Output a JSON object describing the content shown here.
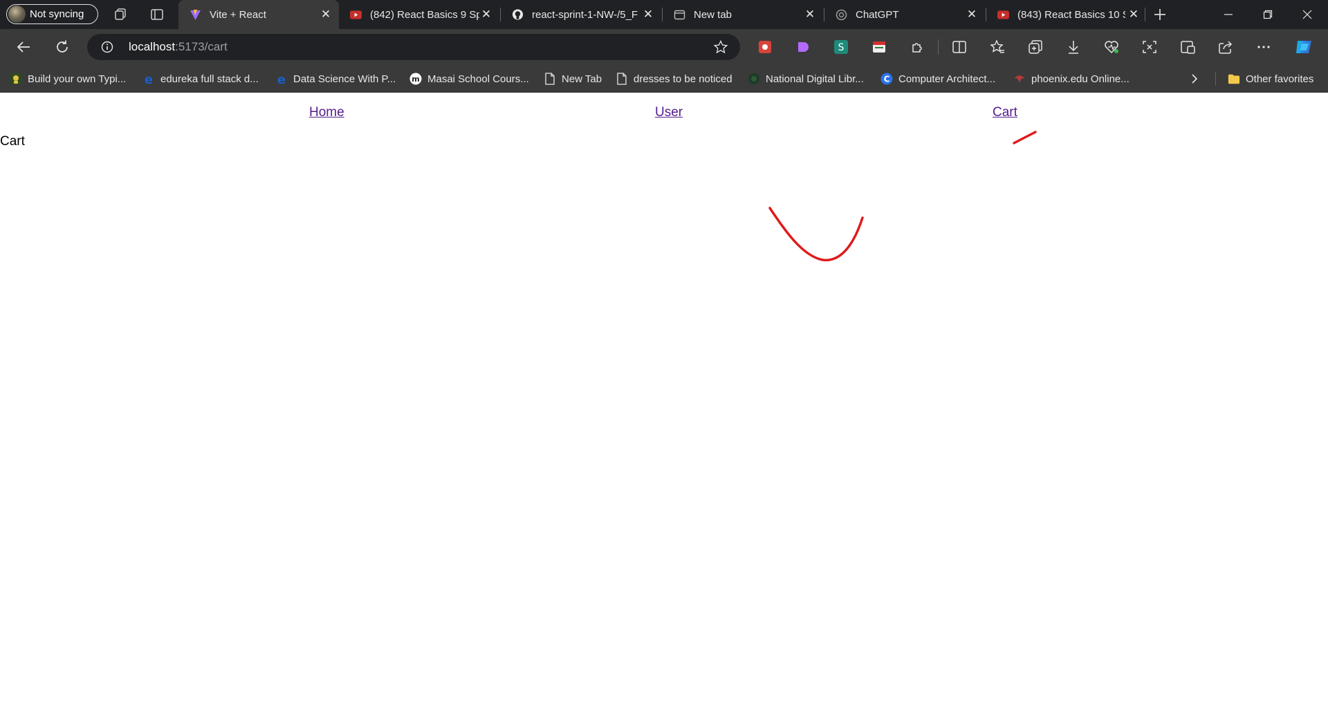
{
  "browser": {
    "profile_label": "Not syncing",
    "tabs": [
      {
        "title": "Vite + React",
        "favicon": "vite-icon",
        "active": true
      },
      {
        "title": "(842) React Basics 9 Spr",
        "favicon": "youtube-icon",
        "active": false
      },
      {
        "title": "react-sprint-1-NW-/5_F",
        "favicon": "github-icon",
        "active": false
      },
      {
        "title": "New tab",
        "favicon": "newtab-icon",
        "active": false
      },
      {
        "title": "ChatGPT",
        "favicon": "chatgpt-icon",
        "active": false
      },
      {
        "title": "(843) React Basics 10 Sp",
        "favicon": "youtube-icon",
        "active": false
      }
    ],
    "address": {
      "host": "localhost",
      "rest": ":5173/cart"
    },
    "bookmarks": [
      {
        "label": "Build your own Typi...",
        "icon": "build-icon"
      },
      {
        "label": "edureka full stack d...",
        "icon": "edureka-icon"
      },
      {
        "label": "Data Science With P...",
        "icon": "edureka-icon"
      },
      {
        "label": "Masai School Cours...",
        "icon": "masai-icon"
      },
      {
        "label": "New Tab",
        "icon": "page-icon"
      },
      {
        "label": "dresses to be noticed",
        "icon": "page-icon"
      },
      {
        "label": "National Digital Libr...",
        "icon": "ndl-icon"
      },
      {
        "label": "Computer Architect...",
        "icon": "coursera-icon"
      },
      {
        "label": "phoenix.edu Online...",
        "icon": "phoenix-icon"
      }
    ],
    "other_favorites": "Other favorites"
  },
  "page": {
    "nav": {
      "home": "Home",
      "user": "User",
      "cart": "Cart"
    },
    "heading": "Cart",
    "colors": {
      "link": "#551a8b",
      "annotation": "#e01b1b"
    }
  }
}
